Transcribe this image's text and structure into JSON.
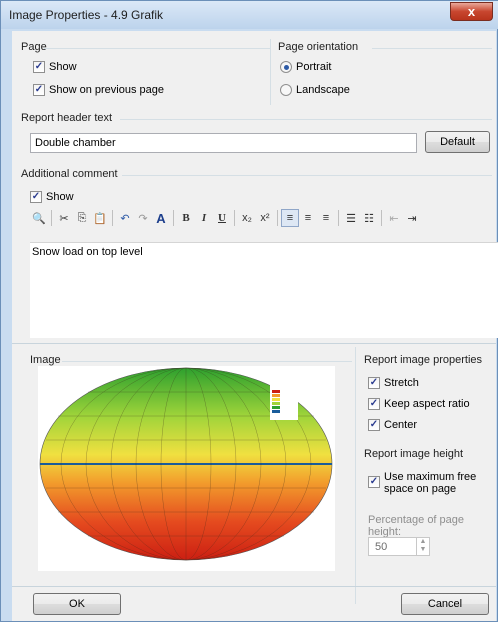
{
  "window": {
    "title": "Image Properties - 4.9 Grafik",
    "close_glyph": "x"
  },
  "page_group": {
    "title": "Page",
    "show_label": "Show",
    "show_checked": true,
    "show_prev_label": "Show on previous page",
    "show_prev_checked": true
  },
  "orientation_group": {
    "title": "Page orientation",
    "portrait_label": "Portrait",
    "landscape_label": "Landscape",
    "selected": "Portrait"
  },
  "header_group": {
    "title": "Report header text",
    "value": "Double chamber",
    "default_button": "Default"
  },
  "comment_group": {
    "title": "Additional comment",
    "show_label": "Show",
    "show_checked": true,
    "text": "Snow load on top level"
  },
  "toolbar": {
    "items": [
      "binoculars-icon",
      "cut-icon",
      "copy-icon",
      "paste-icon",
      "undo-icon",
      "redo-icon",
      "font-color-icon",
      "bold-icon",
      "italic-icon",
      "underline-icon",
      "subscript-icon",
      "superscript-icon",
      "align-left-icon",
      "align-center-icon",
      "align-right-icon",
      "bullet-list-icon",
      "numbered-list-icon",
      "outdent-icon",
      "indent-icon"
    ],
    "bold": "B",
    "italic": "I",
    "underline": "U",
    "font_a": "A"
  },
  "image_group": {
    "title": "Image"
  },
  "report_image_props": {
    "title": "Report image properties",
    "stretch_label": "Stretch",
    "keep_aspect_label": "Keep aspect ratio",
    "center_label": "Center"
  },
  "report_image_height": {
    "title": "Report image height",
    "use_max_label": "Use maximum free space on page",
    "use_max_checked": true,
    "percentage_label": "Percentage of page height:",
    "percentage_value": "50"
  },
  "footer": {
    "ok_label": "OK",
    "cancel_label": "Cancel"
  },
  "colors": {
    "accent": "#2d5aa6",
    "close": "#c8462f"
  }
}
